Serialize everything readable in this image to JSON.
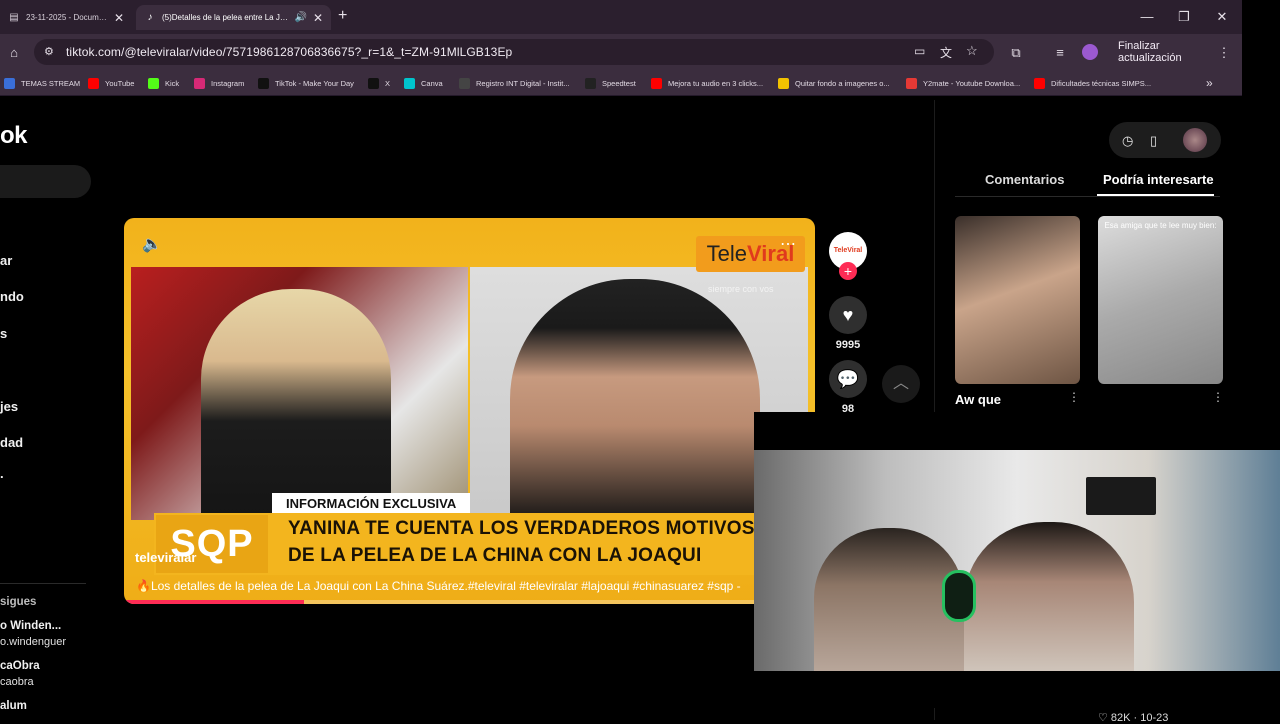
{
  "browser": {
    "tabs": [
      {
        "label": "23-11-2025 - Documentos de G",
        "icon": "docs-icon",
        "active": false
      },
      {
        "label": "(5)Detalles de la pelea entre La Joaqu",
        "icon": "tiktok-icon",
        "active": true
      }
    ],
    "new_tab": "+",
    "window": {
      "minimize": "—",
      "restore": "❐",
      "close": "✕"
    },
    "url": "tiktok.com/@televiralar/video/7571986128706836675?_r=1&_t=ZM-91MlLGB13Ep",
    "update_button": "Finalizar actualización",
    "bookmarks": [
      {
        "label": "TEMAS STREAM",
        "color": "#3a6fd8"
      },
      {
        "label": "YouTube",
        "color": "#ff0000"
      },
      {
        "label": "Kick",
        "color": "#53fc18"
      },
      {
        "label": "Instagram",
        "color": "#d62976"
      },
      {
        "label": "TikTok - Make Your Day",
        "color": "#111111"
      },
      {
        "label": "X",
        "color": "#111111"
      },
      {
        "label": "Canva",
        "color": "#00c4cc"
      },
      {
        "label": "Registro INT Digital - Instit...",
        "color": "#444444"
      },
      {
        "label": "Speedtest",
        "color": "#222222"
      },
      {
        "label": "Mejora tu audio en 3 clicks...",
        "color": "#ff0000"
      },
      {
        "label": "Quitar fondo a imagenes o...",
        "color": "#f2c200"
      },
      {
        "label": "Y2mate - Youtube Downloa...",
        "color": "#e53935"
      },
      {
        "label": "Dificultades técnicas SIMPS...",
        "color": "#ff0000"
      }
    ],
    "bookmarks_more": "»"
  },
  "tiktok": {
    "logo": "ok",
    "sidebar": [
      "ar",
      "ndo",
      "s",
      "jes",
      "dad",
      "."
    ],
    "following_title": "sigues",
    "accounts": [
      {
        "name": "o Winden...",
        "user": "o.windenguer"
      },
      {
        "name": "caObra",
        "user": "caobra"
      },
      {
        "name": "alum",
        "user": ""
      }
    ]
  },
  "video": {
    "overlay_bar": "INFORMACIÓN EXCLUSIVA",
    "sqp": "SQP",
    "headline_1": "YANINA TE CUENTA LOS VERDADEROS MOTIVOS",
    "headline_2": "DE LA PELEA DE LA CHINA CON LA JOAQUI",
    "brand_left": "Tele",
    "brand_right": "Viral",
    "brand_tag": "siempre con vos",
    "handle": "televiralar",
    "caption": "🔥Los detalles de la pelea de La Joaqui con La China Suárez.#televiral #televiralar #lajoaqui #chinasuarez #sqp -",
    "progress": 0.26
  },
  "actions": {
    "avatar_text": "TeleViral",
    "likes": "9995",
    "comments": "98"
  },
  "right_panel": {
    "tabs": [
      "Comentarios",
      "Podría interesarte"
    ],
    "active_tab": 1,
    "thumb1_title": "Aw que",
    "thumb2_caption": "Esa amiga que te lee muy bien:",
    "bottom_stats": "♡ 82K · 10-23"
  }
}
